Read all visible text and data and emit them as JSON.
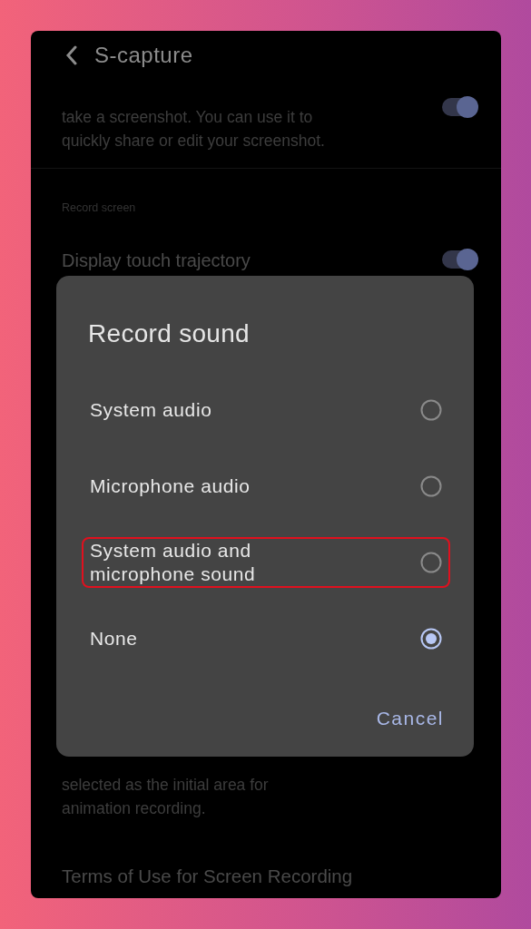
{
  "header": {
    "title": "S-capture"
  },
  "top_item": {
    "description": "take a screenshot. You can use it to quickly share or edit your screenshot.",
    "on": true
  },
  "section_header": "Record screen",
  "touch_item": {
    "title": "Display touch trajectory",
    "on": true
  },
  "lower_item": {
    "description": "selected as the initial area for animation recording."
  },
  "terms_link": "Terms of Use for Screen Recording",
  "dialog": {
    "title": "Record sound",
    "options": [
      {
        "label": "System audio",
        "selected": false,
        "highlighted": false
      },
      {
        "label": "Microphone audio",
        "selected": false,
        "highlighted": false
      },
      {
        "label": "System audio and microphone sound",
        "selected": false,
        "highlighted": true
      },
      {
        "label": "None",
        "selected": true,
        "highlighted": false
      }
    ],
    "cancel": "Cancel"
  }
}
